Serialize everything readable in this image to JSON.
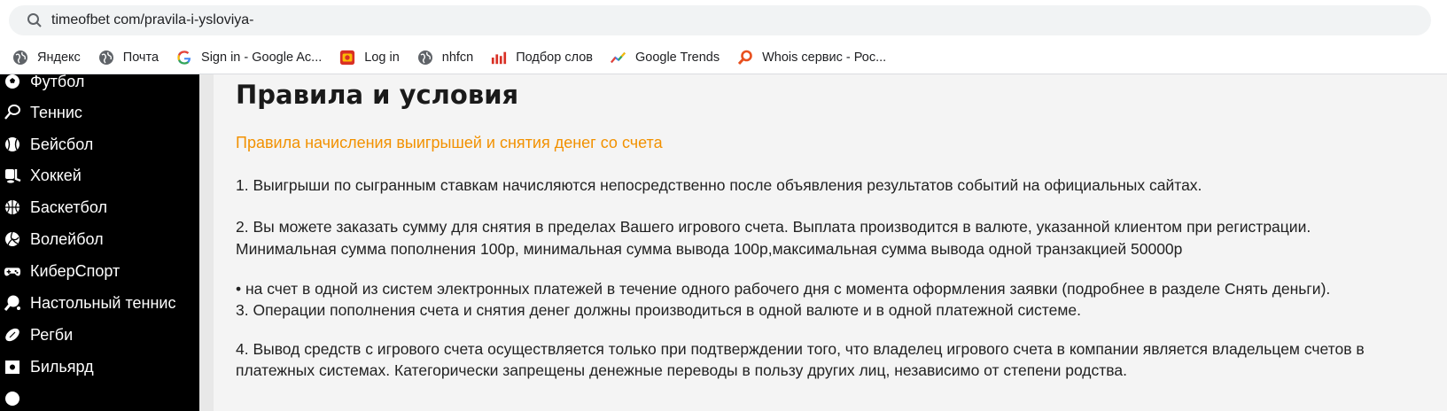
{
  "browser": {
    "url": "timeofbet com/pravila-i-ysloviya-",
    "bookmarks": [
      {
        "label": "Яндекс",
        "icon": "globe-icon"
      },
      {
        "label": "Почта",
        "icon": "globe-icon"
      },
      {
        "label": "Sign in - Google Ac...",
        "icon": "google-g-icon"
      },
      {
        "label": "Log in",
        "icon": "app-icon"
      },
      {
        "label": "nhfcn",
        "icon": "globe-icon"
      },
      {
        "label": "Подбор слов",
        "icon": "bar-chart-icon"
      },
      {
        "label": "Google Trends",
        "icon": "trends-icon"
      },
      {
        "label": "Whois сервис - Рос...",
        "icon": "magnifier-icon"
      }
    ]
  },
  "sidebar": {
    "items": [
      {
        "label": "Футбол",
        "icon": "soccer-ball-icon"
      },
      {
        "label": "Теннис",
        "icon": "tennis-racket-icon"
      },
      {
        "label": "Бейсбол",
        "icon": "baseball-icon"
      },
      {
        "label": "Хоккей",
        "icon": "hockey-icon"
      },
      {
        "label": "Баскетбол",
        "icon": "basketball-icon"
      },
      {
        "label": "Волейбол",
        "icon": "volleyball-icon"
      },
      {
        "label": "КиберСпорт",
        "icon": "gamepad-icon"
      },
      {
        "label": "Настольный теннис",
        "icon": "ping-pong-icon"
      },
      {
        "label": "Регби",
        "icon": "rugby-ball-icon"
      },
      {
        "label": "Бильярд",
        "icon": "billiards-icon"
      }
    ]
  },
  "main": {
    "title": "Правила и условия",
    "subtitle": "Правила начисления выигрышей и снятия денег со счета",
    "paragraphs": [
      "1. Выигрыши по сыгранным ставкам начисляются непосредственно после объявления результатов событий на официальных сайтах.",
      "2. Вы можете заказать сумму для снятия в пределах Вашего игрового счета. Выплата производится в валюте, указанной клиентом при регистрации.",
      "Минимальная сумма пополнения 100р, минимальная сумма вывода 100р,максимальная сумма вывода одной транзакцией 50000р",
      "• на счет в одной из систем электронных платежей в течение одного рабочего дня с момента оформления заявки (подробнее в разделе Снять деньги).",
      "3. Операции пополнения счета и снятия денег должны производиться в одной валюте и в одной платежной системе.",
      "4. Вывод средств с игрового счета осуществляется только при подтверждении того, что владелец игрового счета в компании является владельцем счетов в",
      "платежных системах. Категорически запрещены денежные переводы в пользу других лиц, независимо от степени родства."
    ]
  },
  "colors": {
    "sidebar_bg": "#000000",
    "content_bg": "#f4f4f4",
    "accent_orange": "#f29100",
    "omnibox_bg": "#f1f3f4"
  }
}
